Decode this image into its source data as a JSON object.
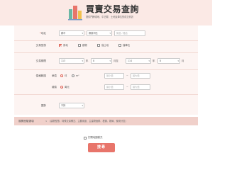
{
  "header": {
    "title": "買賣交易查詢",
    "subtitle": "提供門牌或地、中古屋、土地及車位的成交資訊"
  },
  "location": {
    "label": "地址",
    "city": "縣市",
    "district": "鄉鎮市區",
    "road_placeholder": "街道／路名"
  },
  "trade_type": {
    "label": "交易型態",
    "options": [
      {
        "label": "房地",
        "checked": true
      },
      {
        "label": "建物",
        "checked": false
      },
      {
        "label": "僅土地",
        "checked": false
      },
      {
        "label": "僅車位",
        "checked": false
      }
    ]
  },
  "period": {
    "label": "交易期間",
    "from_year": "113",
    "year_unit_1": "年",
    "from_month": "8",
    "month_unit_1": "月至",
    "to_year": "114",
    "year_unit_2": "年",
    "to_month": "8",
    "month_unit_2": "月"
  },
  "price": {
    "label": "價格範圍",
    "unit_label": "單價",
    "unit_opt_1": "坪",
    "unit_opt_2": "m²",
    "unit_min_placeholder": "最小值",
    "unit_max_placeholder": "最大值",
    "total_label": "總價",
    "total_opt": "萬元",
    "total_min_placeholder": "最小值",
    "total_max_placeholder": "最大值",
    "range_sep": "~"
  },
  "age": {
    "label": "屋齡",
    "value": "不拘"
  },
  "advanced": {
    "label": "展開進階選項",
    "chevron": "∨",
    "description": "(建物型態、特殊交易備註、主要用途、主建物面積、樓層、格局、使用分區)"
  },
  "map_mode": {
    "label": "打開地圖模式"
  },
  "search_button": "搜尋",
  "colors": {
    "accent": "#e8756b",
    "header_bg": "#fbe9e5",
    "form_bg": "#fdf4f2"
  }
}
